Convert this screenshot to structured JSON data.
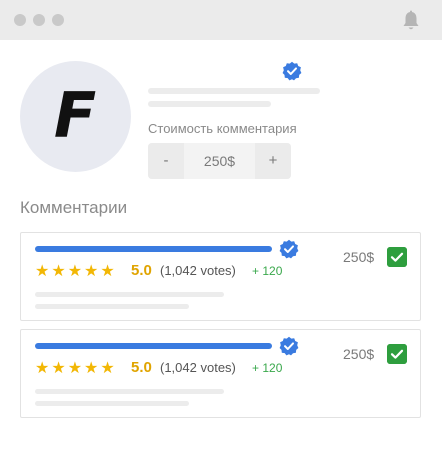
{
  "profile": {
    "avatar_letter": "F",
    "cost_label": "Стоимость комментария",
    "stepper": {
      "minus": "-",
      "value": "250$",
      "plus": "+"
    }
  },
  "comments": {
    "title": "Комментарии",
    "items": [
      {
        "stars": "★★★★★",
        "score": "5.0",
        "votes": "(1,042 votes)",
        "delta": "+ 120",
        "price": "250$",
        "checked": true
      },
      {
        "stars": "★★★★★",
        "score": "5.0",
        "votes": "(1,042 votes)",
        "delta": "+ 120",
        "price": "250$",
        "checked": true
      }
    ]
  },
  "colors": {
    "accent_blue": "#3a7be0",
    "verified_blue": "#3a7be0",
    "star_yellow": "#f2b705",
    "check_green": "#2e9e3e",
    "delta_green": "#3aa84c"
  },
  "icons": {
    "window_controls": [
      "dot-icon",
      "dot-icon",
      "dot-icon"
    ],
    "notification": "bell-icon",
    "verified": "verified-badge-icon",
    "checkbox": "checkmark-icon"
  }
}
